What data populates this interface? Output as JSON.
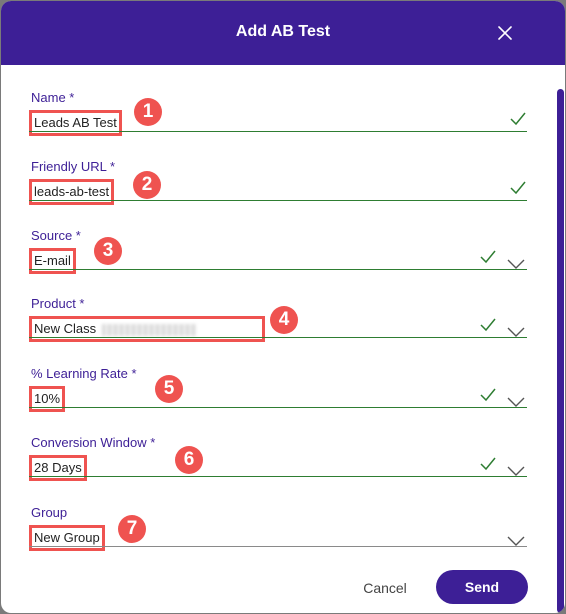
{
  "dialog": {
    "title": "Add AB Test",
    "close_icon": "close-icon"
  },
  "fields": [
    {
      "label": "Name *",
      "value": "Leads AB Test",
      "badge": "1"
    },
    {
      "label": "Friendly URL *",
      "value": "leads-ab-test",
      "badge": "2"
    },
    {
      "label": "Source *",
      "value": "E-mail",
      "badge": "3"
    },
    {
      "label": "Product *",
      "value": "New Class",
      "badge": "4"
    },
    {
      "label": "% Learning Rate *",
      "value": "10%",
      "badge": "5"
    },
    {
      "label": "Conversion Window *",
      "value": "28 Days",
      "badge": "6"
    },
    {
      "label": "Group",
      "value": "New Group",
      "badge": "7"
    }
  ],
  "actions": {
    "cancel_label": "Cancel",
    "send_label": "Send"
  },
  "colors": {
    "header": "#3d1f96",
    "accent": "#3d1f96",
    "valid": "#2e7d32",
    "highlight": "#ef5350"
  }
}
